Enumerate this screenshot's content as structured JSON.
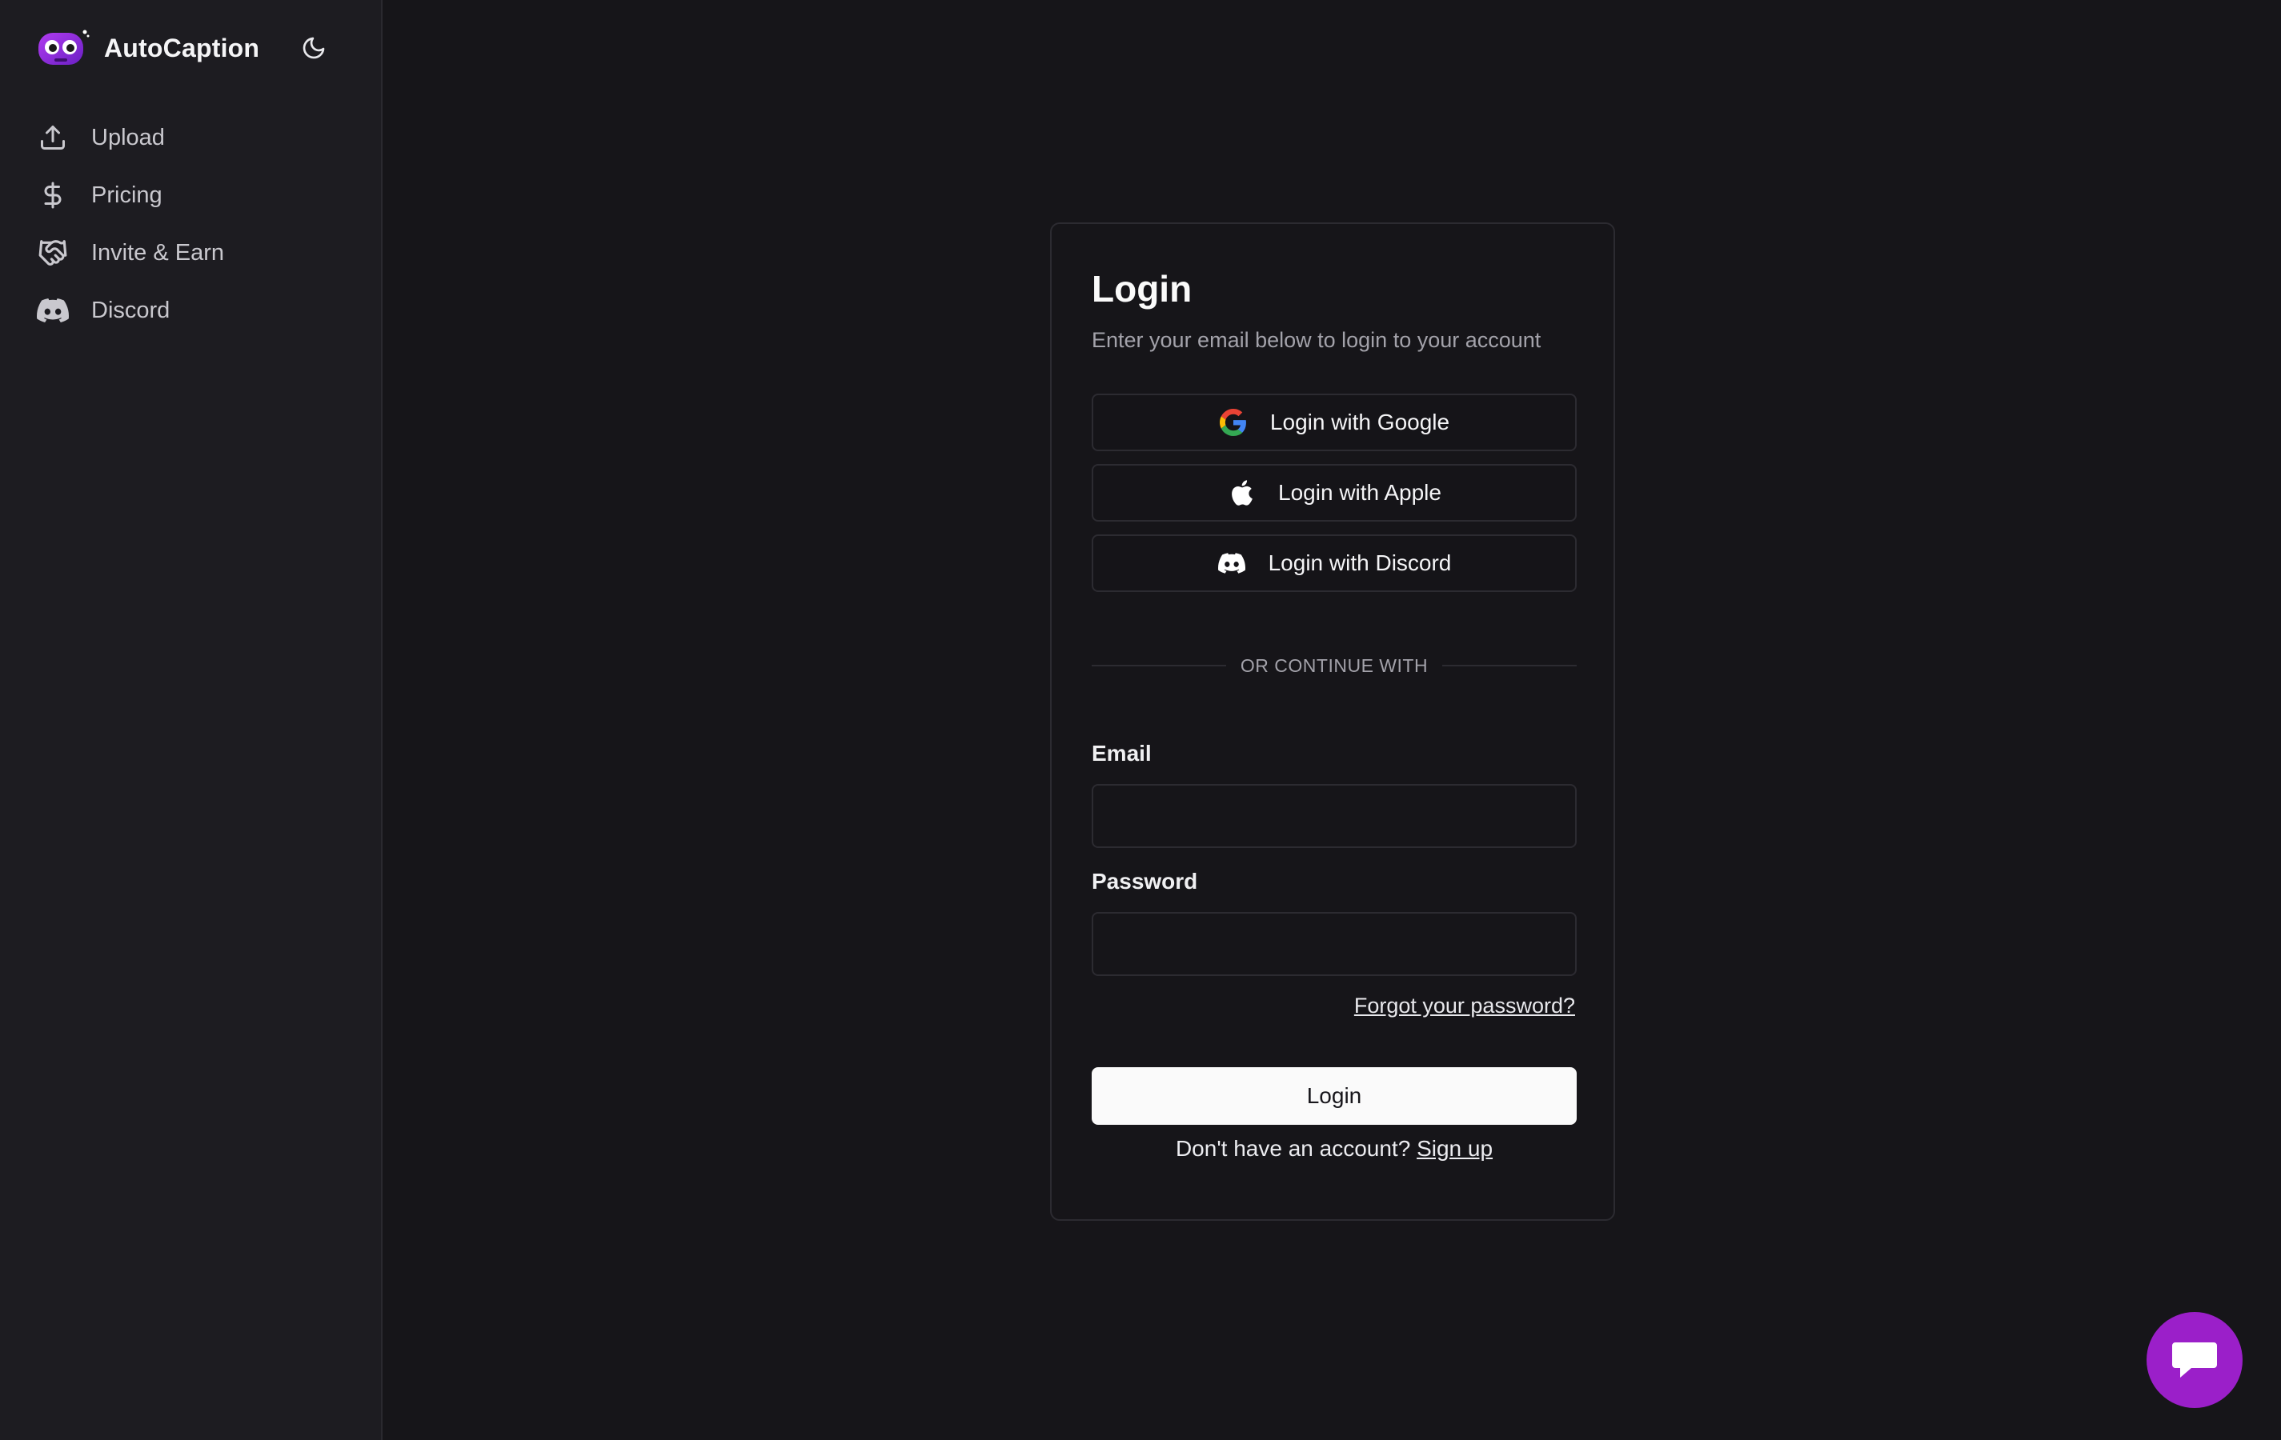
{
  "app": {
    "name": "AutoCaption"
  },
  "sidebar": {
    "items": [
      {
        "label": "Upload",
        "icon": "upload-icon"
      },
      {
        "label": "Pricing",
        "icon": "dollar-icon"
      },
      {
        "label": "Invite & Earn",
        "icon": "handshake-icon"
      },
      {
        "label": "Discord",
        "icon": "discord-icon"
      }
    ]
  },
  "login": {
    "title": "Login",
    "subtitle": "Enter your email below to login to your account",
    "google_label": "Login with Google",
    "apple_label": "Login with Apple",
    "discord_label": "Login with Discord",
    "divider_text": "OR CONTINUE WITH",
    "email_label": "Email",
    "email_value": "",
    "password_label": "Password",
    "password_value": "",
    "forgot_label": "Forgot your password?",
    "submit_label": "Login",
    "signup_prompt": "Don't have an account?",
    "signup_link": "Sign up"
  },
  "colors": {
    "background": "#161519",
    "sidebar": "#1d1c21",
    "border": "#2c2b31",
    "chat_button": "#9b1fc9",
    "brand_purple": "#8a2be2"
  }
}
